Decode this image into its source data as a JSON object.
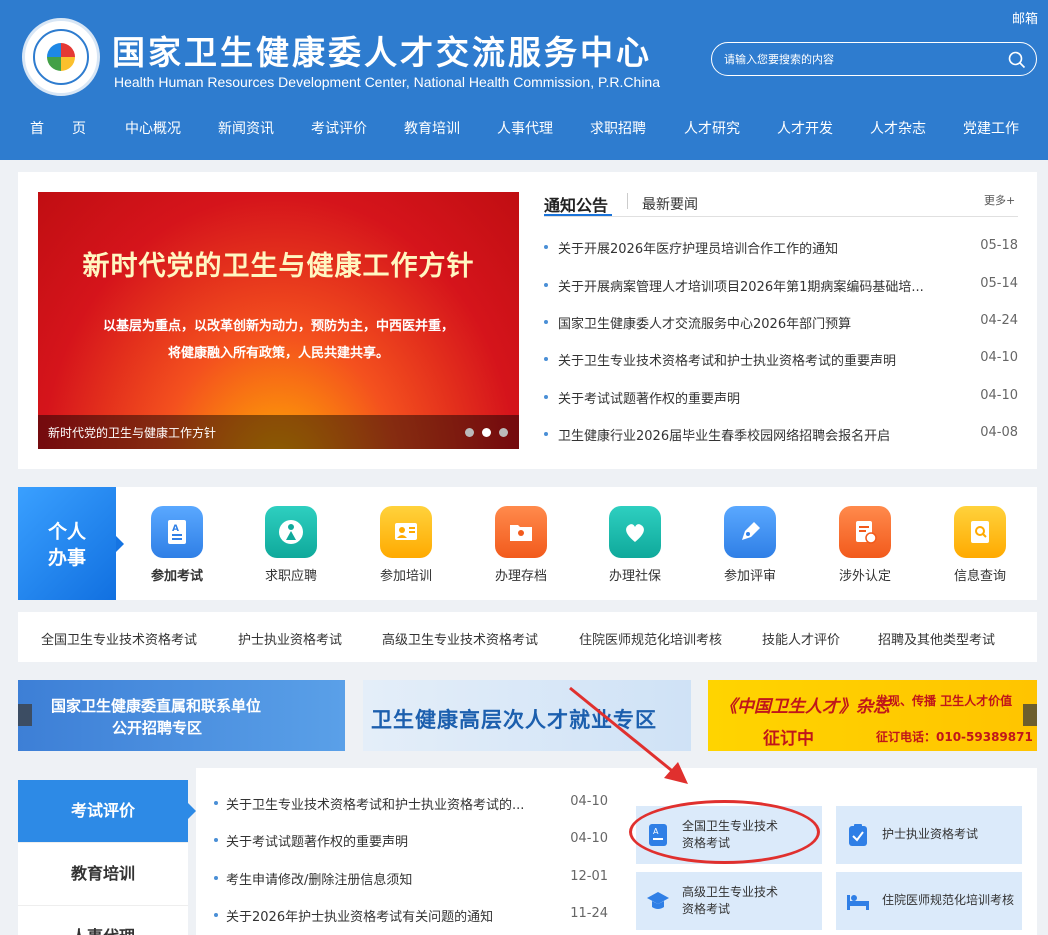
{
  "header": {
    "title": "国家卫生健康委人才交流服务中心",
    "subtitle": "Health Human Resources Development Center, National Health Commission, P.R.China",
    "mail": "邮箱",
    "search_placeholder": "请输入您要搜索的内容"
  },
  "nav": [
    "首　　页",
    "中心概况",
    "新闻资讯",
    "考试评价",
    "教育培训",
    "人事代理",
    "求职招聘",
    "人才研究",
    "人才开发",
    "人才杂志",
    "党建工作"
  ],
  "slider": {
    "headline": "新时代党的卫生与健康工作方针",
    "sub1": "以基层为重点，以改革创新为动力，预防为主，中西医并重，",
    "sub2": "将健康融入所有政策，人民共建共享。",
    "caption": "新时代党的卫生与健康工作方针",
    "active_dot": 2
  },
  "news": {
    "tab_active": "通知公告",
    "tab_2": "最新要闻",
    "more": "更多+",
    "items": [
      {
        "title": "关于开展2026年医疗护理员培训合作工作的通知",
        "date": "05-18"
      },
      {
        "title": "关于开展病案管理人才培训项目2026年第1期病案编码基础培...",
        "date": "05-14"
      },
      {
        "title": "国家卫生健康委人才交流服务中心2026年部门预算",
        "date": "04-24"
      },
      {
        "title": "关于卫生专业技术资格考试和护士执业资格考试的重要声明",
        "date": "04-10"
      },
      {
        "title": "关于考试试题著作权的重要声明",
        "date": "04-10"
      },
      {
        "title": "卫生健康行业2026届毕业生春季校园网络招聘会报名开启",
        "date": "04-08"
      }
    ]
  },
  "personal": {
    "label_line1": "个人",
    "label_line2": "办事",
    "services": [
      {
        "label": "参加考试",
        "icon": "exam-icon",
        "color": "#2f86f0"
      },
      {
        "label": "求职应聘",
        "icon": "job-icon",
        "color": "#12b3a6"
      },
      {
        "label": "参加培训",
        "icon": "training-icon",
        "color": "#ffb400"
      },
      {
        "label": "办理存档",
        "icon": "archive-icon",
        "color": "#ff6a2b"
      },
      {
        "label": "办理社保",
        "icon": "social-security-icon",
        "color": "#12b3a6"
      },
      {
        "label": "参加评审",
        "icon": "review-icon",
        "color": "#2f86f0"
      },
      {
        "label": "涉外认定",
        "icon": "foreign-cert-icon",
        "color": "#ff6a2b"
      },
      {
        "label": "信息查询",
        "icon": "info-query-icon",
        "color": "#ffb400"
      }
    ]
  },
  "exam_links": [
    "全国卫生专业技术资格考试",
    "护士执业资格考试",
    "高级卫生专业技术资格考试",
    "住院医师规范化培训考核",
    "技能人才评价",
    "招聘及其他类型考试"
  ],
  "banners": {
    "b1_line1": "国家卫生健康委直属和联系单位",
    "b1_line2": "公开招聘专区",
    "b2": "卫生健康高层次人才就业专区",
    "b3_title": "《中国卫生人才》杂志",
    "b3_slogan": "发现、传播 卫生人才价值",
    "b3_order": "征订中",
    "b3_phone": "征订电话：010-59389871"
  },
  "side_tabs": [
    "考试评价",
    "教育培训",
    "人事代理"
  ],
  "exam_news": [
    {
      "title": "关于卫生专业技术资格考试和护士执业资格考试的...",
      "date": "04-10"
    },
    {
      "title": "关于考试试题著作权的重要声明",
      "date": "04-10"
    },
    {
      "title": "考生申请修改/删除注册信息须知",
      "date": "12-01"
    },
    {
      "title": "关于2026年护士执业资格考试有关问题的通知",
      "date": "11-24"
    }
  ],
  "quick_links": [
    {
      "l1": "全国卫生专业技术",
      "l2": "资格考试",
      "icon": "exam-doc-icon"
    },
    {
      "l1": "护士执业资格考试",
      "l2": "",
      "icon": "clipboard-check-icon"
    },
    {
      "l1": "高级卫生专业技术",
      "l2": "资格考试",
      "icon": "graduation-cap-icon"
    },
    {
      "l1": "住院医师规范化培训考核",
      "l2": "",
      "icon": "hospital-bed-icon"
    }
  ]
}
